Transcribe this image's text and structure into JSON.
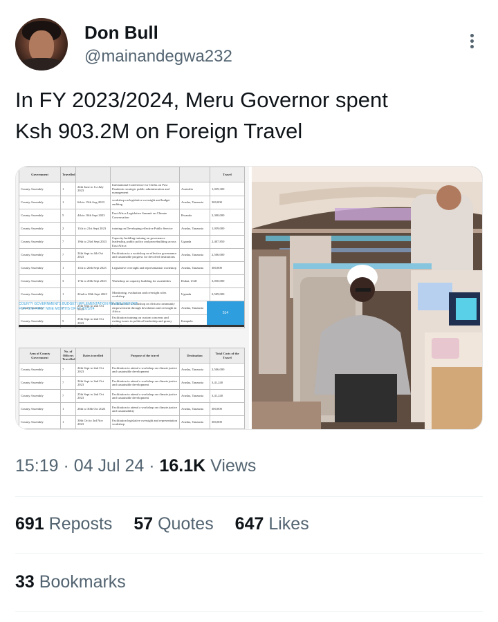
{
  "author": {
    "display_name": "Don Bull",
    "handle": "@mainandegwa232"
  },
  "tweet": {
    "text_line1": "In FY 2023/2024, Meru Governor spent",
    "text_line2": "Ksh 903.2M on Foreign Travel"
  },
  "document": {
    "top_header": [
      "Government",
      "Travelled",
      "",
      "",
      "Travel"
    ],
    "top_rows": [
      [
        "County Assembly",
        "1",
        "24th June to 1st July 2023",
        "International Conference for Clerks on Post Pandemic strategic public administration and management",
        "Australia",
        "1,039,300"
      ],
      [
        "County Assembly",
        "1",
        "6th to 15th Aug 2023",
        "workshop on legislative oversight and budget auditing",
        "Arusha, Tanzania",
        "300,000"
      ],
      [
        "County Assembly",
        "5",
        "4th to 10th Sept 2023",
        "East Africa Legislative Summit on Climate Conversation",
        "Rwanda",
        "2,300,000"
      ],
      [
        "County Assembly",
        "2",
        "11th to 21st Sept 2023",
        "training on Developing effective Public Service",
        "Arusha, Tanzania",
        "1,039,000"
      ],
      [
        "County Assembly",
        "7",
        "19th to 23rd Sept 2023",
        "Capacity-building training on governance leadership, public policy and peacebuilding across East Africa",
        "Uganda",
        "2,407,850"
      ],
      [
        "County Assembly",
        "7",
        "24th Sept to 4th Oct 2023",
        "Facilitation to a workshop on effective governance and sustainable progress for devolved institutions",
        "Arusha, Tanzania",
        "2,506,000"
      ],
      [
        "County Assembly",
        "1",
        "11th to 20th Sept 2023",
        "Legislative oversight and representation workshop",
        "Arusha, Tanzania",
        "300,000"
      ],
      [
        "County Assembly",
        "3",
        "17th to 20th Sept 2023",
        "Workshop on capacity building for assemblies",
        "Dubai, UAE",
        "3,050,000"
      ],
      [
        "County Assembly",
        "1",
        "22nd to 28th Sept 2023",
        "Monitoring, evaluation and oversight roles workshop",
        "Uganda",
        "2,509,000"
      ],
      [
        "County Assembly",
        "7",
        "25th Sept to 2nd Oct 2023",
        "Facilitation to a workshop on African community empowerment through devolution and oversight in Africa",
        "Arusha, Tanzania",
        "3,41,240"
      ],
      [
        "County Assembly",
        "5",
        "25th Sept to 2nd Oct 2023",
        "Facilitation training on custom concerns and exiting issues in political leadership and grassy institutions",
        "Kampala",
        "2,506,000"
      ]
    ],
    "caption_line1": "COUNTY GOVERNMENTS BUDGET IMPLEMENTATION REVIEW REPORT",
    "caption_line2": "FOR THE FIRST NINE MONTHS OF FY 2023/24",
    "box_label": "514",
    "bottom_header": [
      "Arm of County Government",
      "No. of Officers Travelled",
      "Dates travelled",
      "Purpose of the travel",
      "Destination",
      "Total Costs of the Travel"
    ],
    "bottom_rows": [
      [
        "County Assembly",
        "7",
        "24th Sept to 2nd Oct 2023",
        "Facilitation to attend a workshop on climate justice and sustainable development",
        "Arusha, Tanzania",
        "2,506,000"
      ],
      [
        "County Assembly",
        "7",
        "24th Sept to 2nd Oct 2023",
        "Facilitation to attend a workshop on climate justice and sustainable development",
        "Arusha, Tanzania",
        "3,41,240"
      ],
      [
        "County Assembly",
        "7",
        "25th Sept to 2nd Oct 2023",
        "Facilitation to attend a workshop on climate justice and sustainable development",
        "Arusha, Tanzania",
        "3,41,240"
      ],
      [
        "County Assembly",
        "1",
        "26th to 30th Oct 2023",
        "Facilitation to attend a workshop on climate justice and sustainability",
        "Arusha, Tanzania",
        "300,000"
      ],
      [
        "County Assembly",
        "1",
        "30th Oct to 3rd Nov 2023",
        "Facilitation legislative oversight and representation workshop",
        "Arusha, Tanzania",
        "300,000"
      ]
    ]
  },
  "meta": {
    "time": "15:19",
    "sep1": "·",
    "date": "04 Jul 24",
    "sep2": "·",
    "views_count": "16.1K",
    "views_label": "Views"
  },
  "stats": {
    "reposts_count": "691",
    "reposts_label": "Reposts",
    "quotes_count": "57",
    "quotes_label": "Quotes",
    "likes_count": "647",
    "likes_label": "Likes",
    "bookmarks_count": "33",
    "bookmarks_label": "Bookmarks"
  },
  "colors": {
    "text_primary": "#0f1419",
    "text_secondary": "#536471",
    "divider": "#eff3f4",
    "report_blue": "#2e9ede"
  },
  "icons": {
    "more": "vertical-ellipsis-icon"
  }
}
